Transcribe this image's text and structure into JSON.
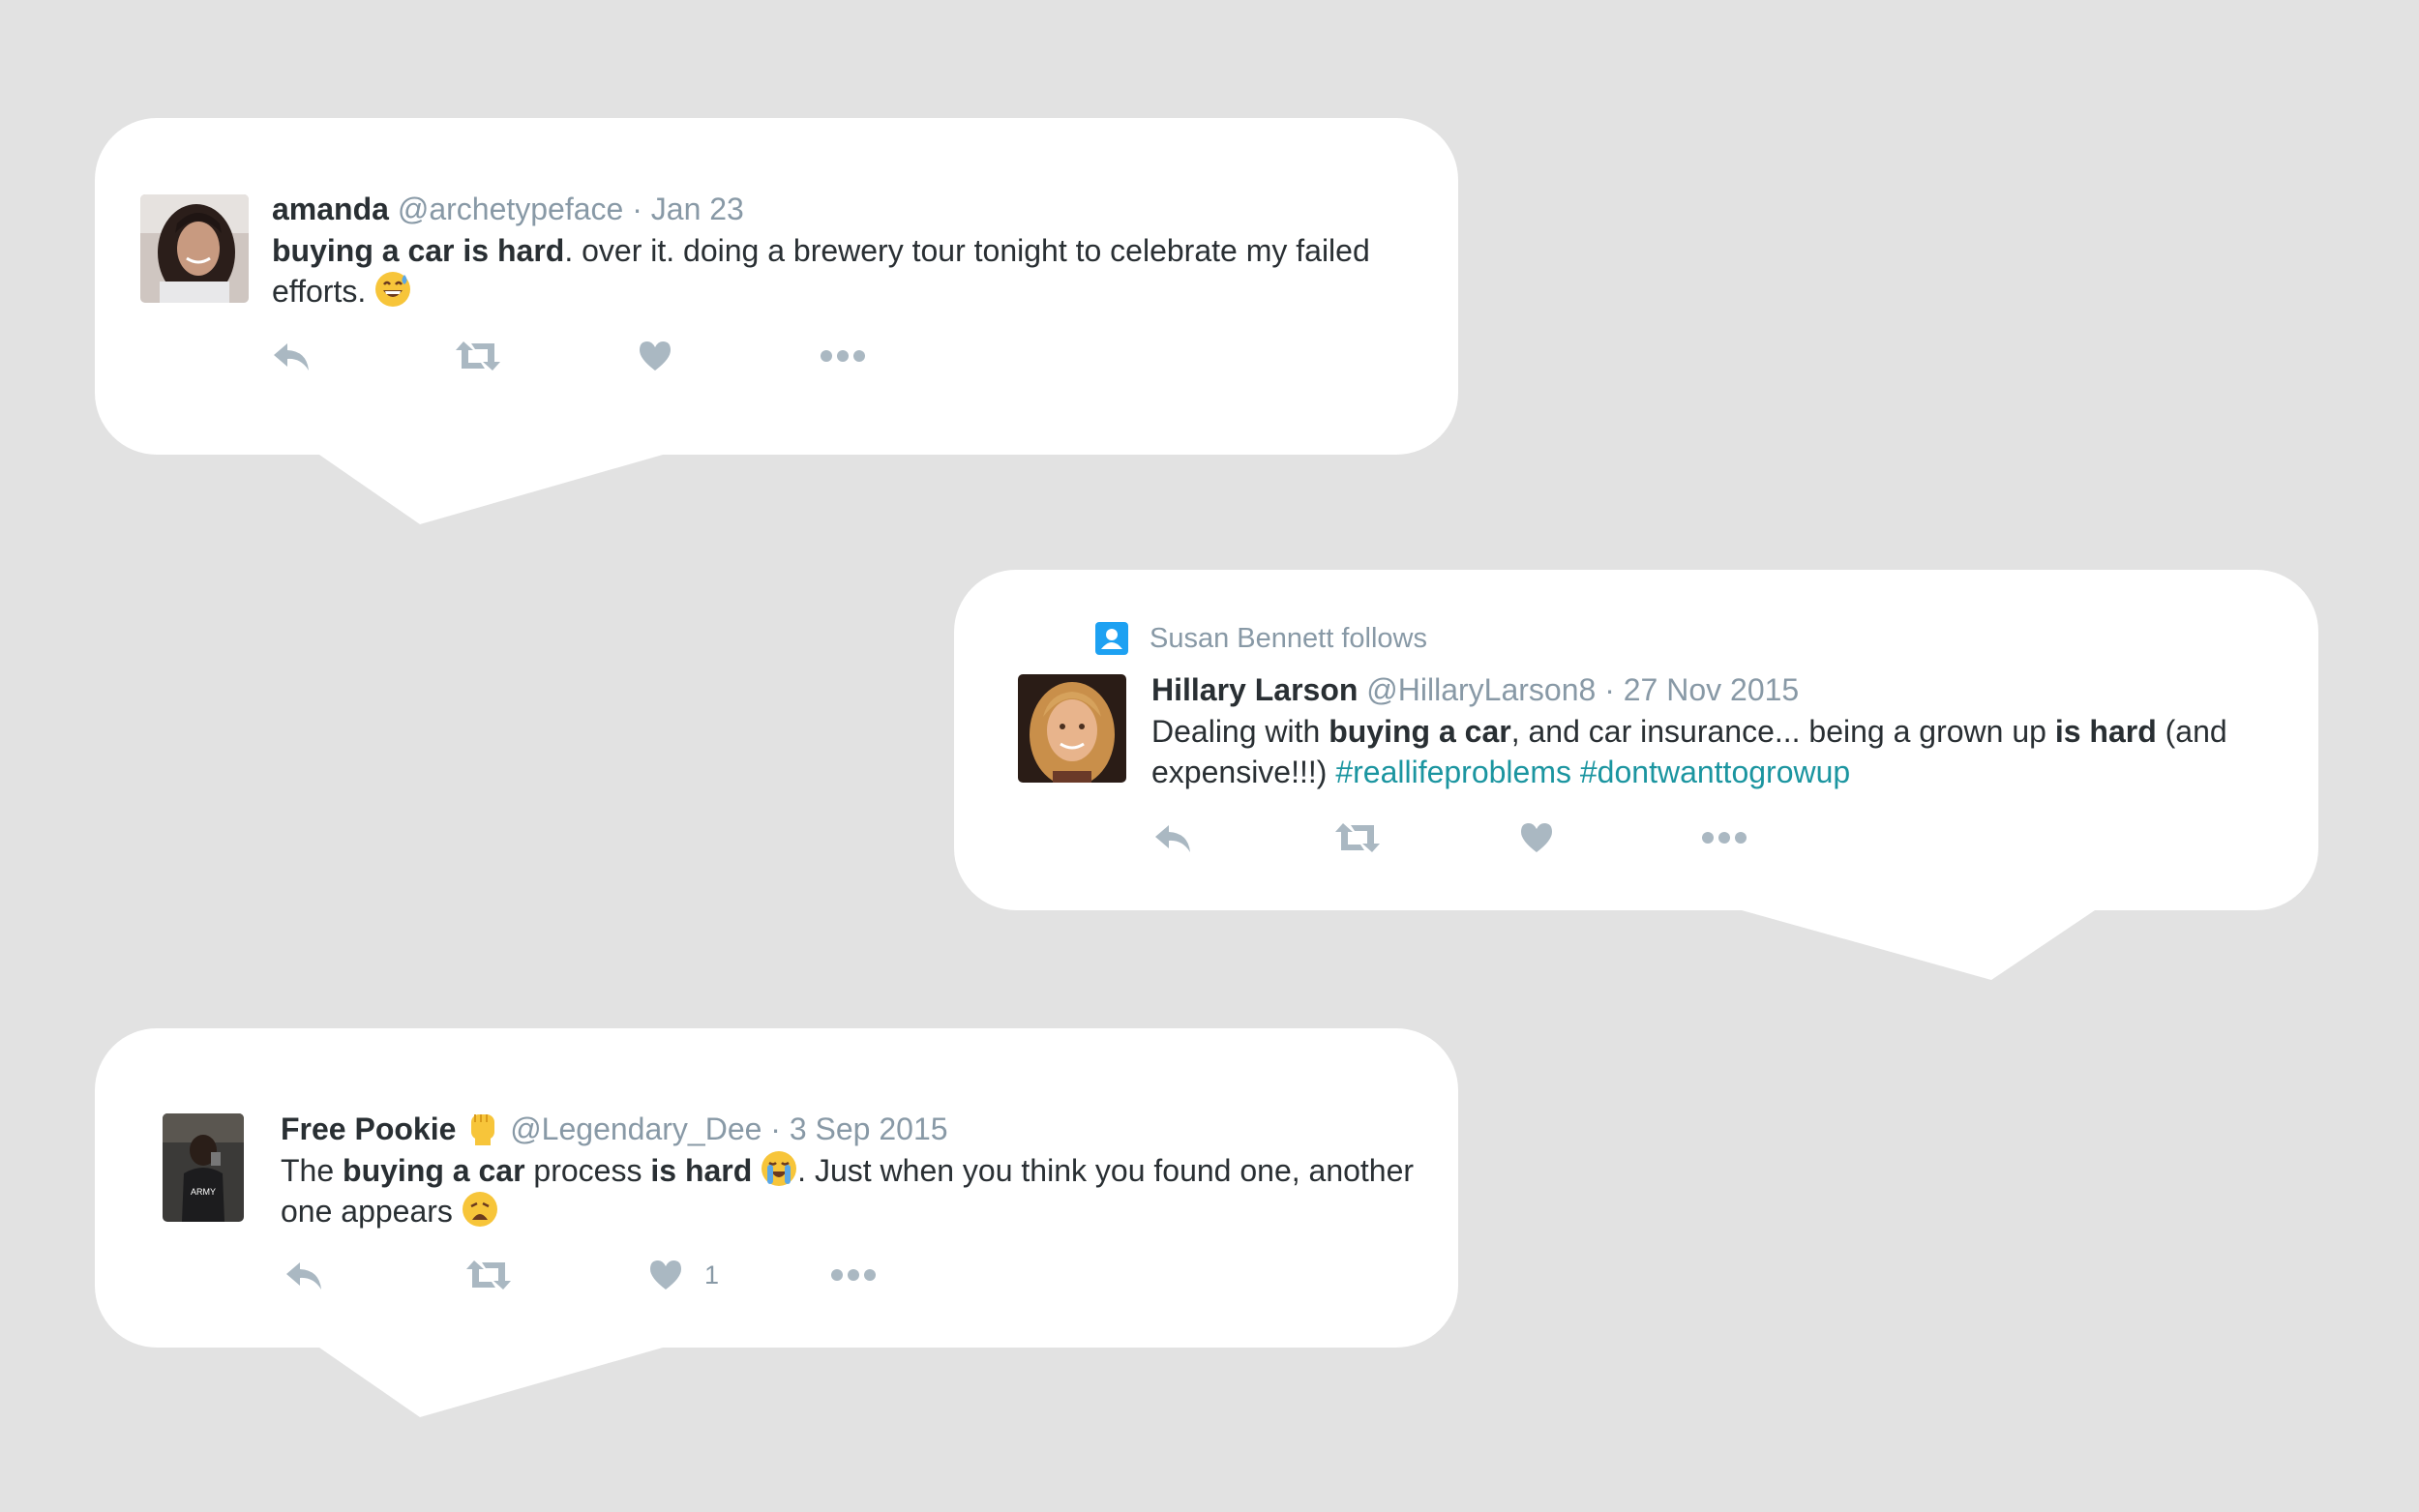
{
  "tweets": [
    {
      "name": "amanda",
      "handle": "@archetypeface",
      "date": "Jan 23",
      "text": [
        {
          "t": "buying a car is hard",
          "bold": true
        },
        {
          "t": ". over it. doing a brewery tour tonight to celebrate my failed efforts. "
        }
      ],
      "emoji": [
        "grinning-sweat-emoji"
      ]
    },
    {
      "context": "Susan Bennett follows",
      "name": "Hillary Larson",
      "handle": "@HillaryLarson8",
      "date": "27 Nov 2015",
      "text": [
        {
          "t": "Dealing with "
        },
        {
          "t": "buying a car",
          "bold": true
        },
        {
          "t": ", and car insurance... being a grown up "
        },
        {
          "t": "is hard",
          "bold": true
        },
        {
          "t": " (and expensive!!!) "
        },
        {
          "t": "#reallifeproblems",
          "hashtag": true
        },
        {
          "t": " "
        },
        {
          "t": "#dontwanttogrowup",
          "hashtag": true
        }
      ]
    },
    {
      "name": "Free Pookie",
      "handle": "@Legendary_Dee",
      "date": "3 Sep 2015",
      "like_count": "1",
      "name_emoji": "raised-fist-emoji",
      "text": [
        {
          "t": "The "
        },
        {
          "t": "buying a car",
          "bold": true
        },
        {
          "t": " process "
        },
        {
          "t": "is hard",
          "bold": true
        },
        {
          "t": " "
        },
        {
          "emoji": "loudly-crying-emoji"
        },
        {
          "t": ". Just when you think you found one, another one appears "
        },
        {
          "emoji": "weary-face-emoji"
        }
      ]
    }
  ],
  "separators": {
    "dot": " · "
  },
  "colors": {
    "background": "#e2e2e2",
    "card": "#ffffff",
    "text": "#292f33",
    "meta": "#8899a6",
    "action_icon": "#aab8c2",
    "hashtag": "#1b95a0",
    "follow_icon": "#1da1f2"
  },
  "icons": [
    "reply-icon",
    "retweet-icon",
    "like-icon",
    "more-icon",
    "follow-context-icon"
  ]
}
